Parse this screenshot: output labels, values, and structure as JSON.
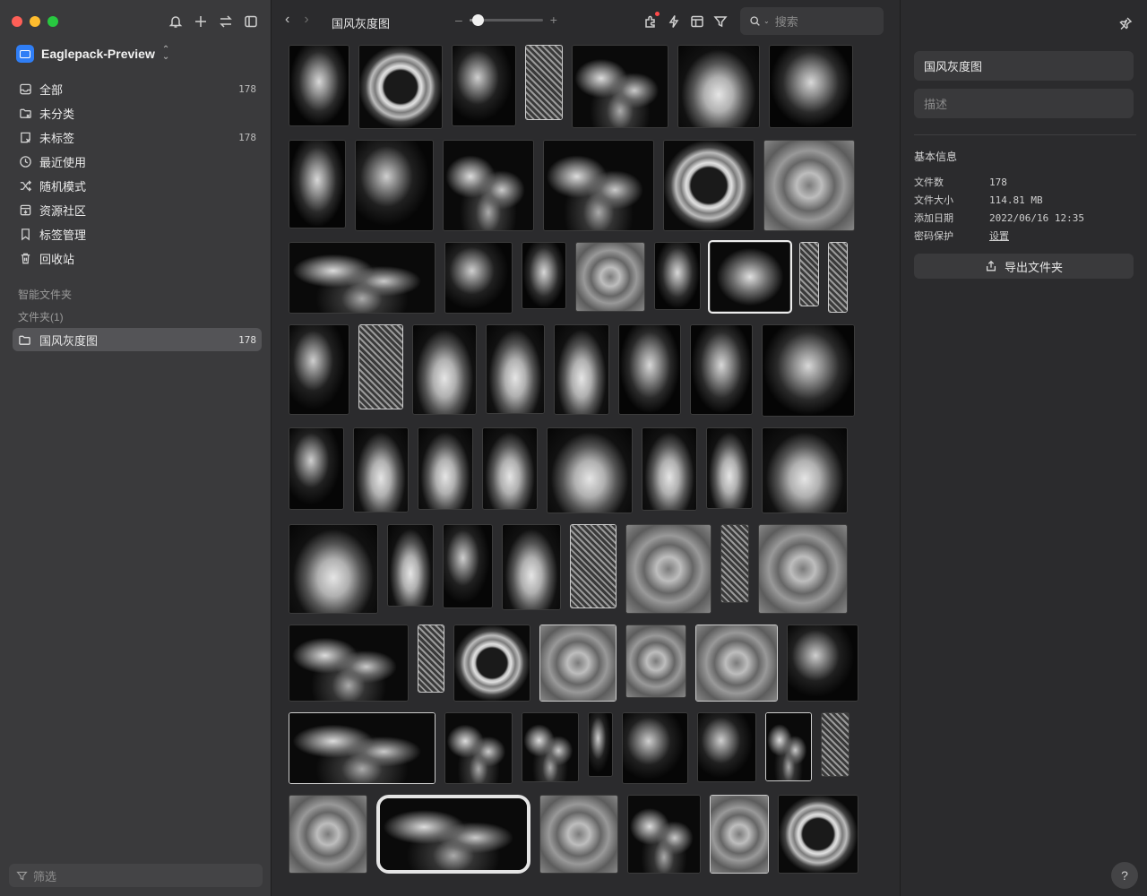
{
  "window": {
    "traffic_lights": [
      "close",
      "minimize",
      "zoom"
    ]
  },
  "sidebar": {
    "library_name": "Eaglepack-Preview",
    "nav": [
      {
        "label": "全部",
        "icon": "inbox-icon",
        "count": "178"
      },
      {
        "label": "未分类",
        "icon": "folder-question-icon",
        "count": ""
      },
      {
        "label": "未标签",
        "icon": "tag-off-icon",
        "count": "178"
      },
      {
        "label": "最近使用",
        "icon": "clock-icon",
        "count": ""
      },
      {
        "label": "随机模式",
        "icon": "shuffle-icon",
        "count": ""
      },
      {
        "label": "资源社区",
        "icon": "archive-icon",
        "count": ""
      },
      {
        "label": "标签管理",
        "icon": "bookmark-icon",
        "count": ""
      },
      {
        "label": "回收站",
        "icon": "trash-icon",
        "count": ""
      }
    ],
    "smart_folders_label": "智能文件夹",
    "folders_label": "文件夹(1)",
    "folder": {
      "label": "国风灰度图",
      "count": "178"
    },
    "filter_placeholder": "筛选"
  },
  "toolbar": {
    "title": "国风灰度图",
    "zoom_minus": "–",
    "zoom_plus": "+",
    "zoom_level": 0.05,
    "search_placeholder": "搜索"
  },
  "inspector": {
    "name_value": "国风灰度图",
    "desc_placeholder": "描述",
    "section_title": "基本信息",
    "rows": [
      {
        "key": "文件数",
        "value": "178"
      },
      {
        "key": "文件大小",
        "value": "114.81 MB"
      },
      {
        "key": "添加日期",
        "value": "2022/06/16 12:35"
      },
      {
        "key": "密码保护",
        "value": "设置"
      }
    ],
    "export_label": "导出文件夹",
    "help_label": "?"
  },
  "colors": {
    "accent": "#2f7ef6",
    "sidebar_bg": "#3a3a3c",
    "main_bg": "#2b2b2d",
    "selected_row": "#545457"
  }
}
